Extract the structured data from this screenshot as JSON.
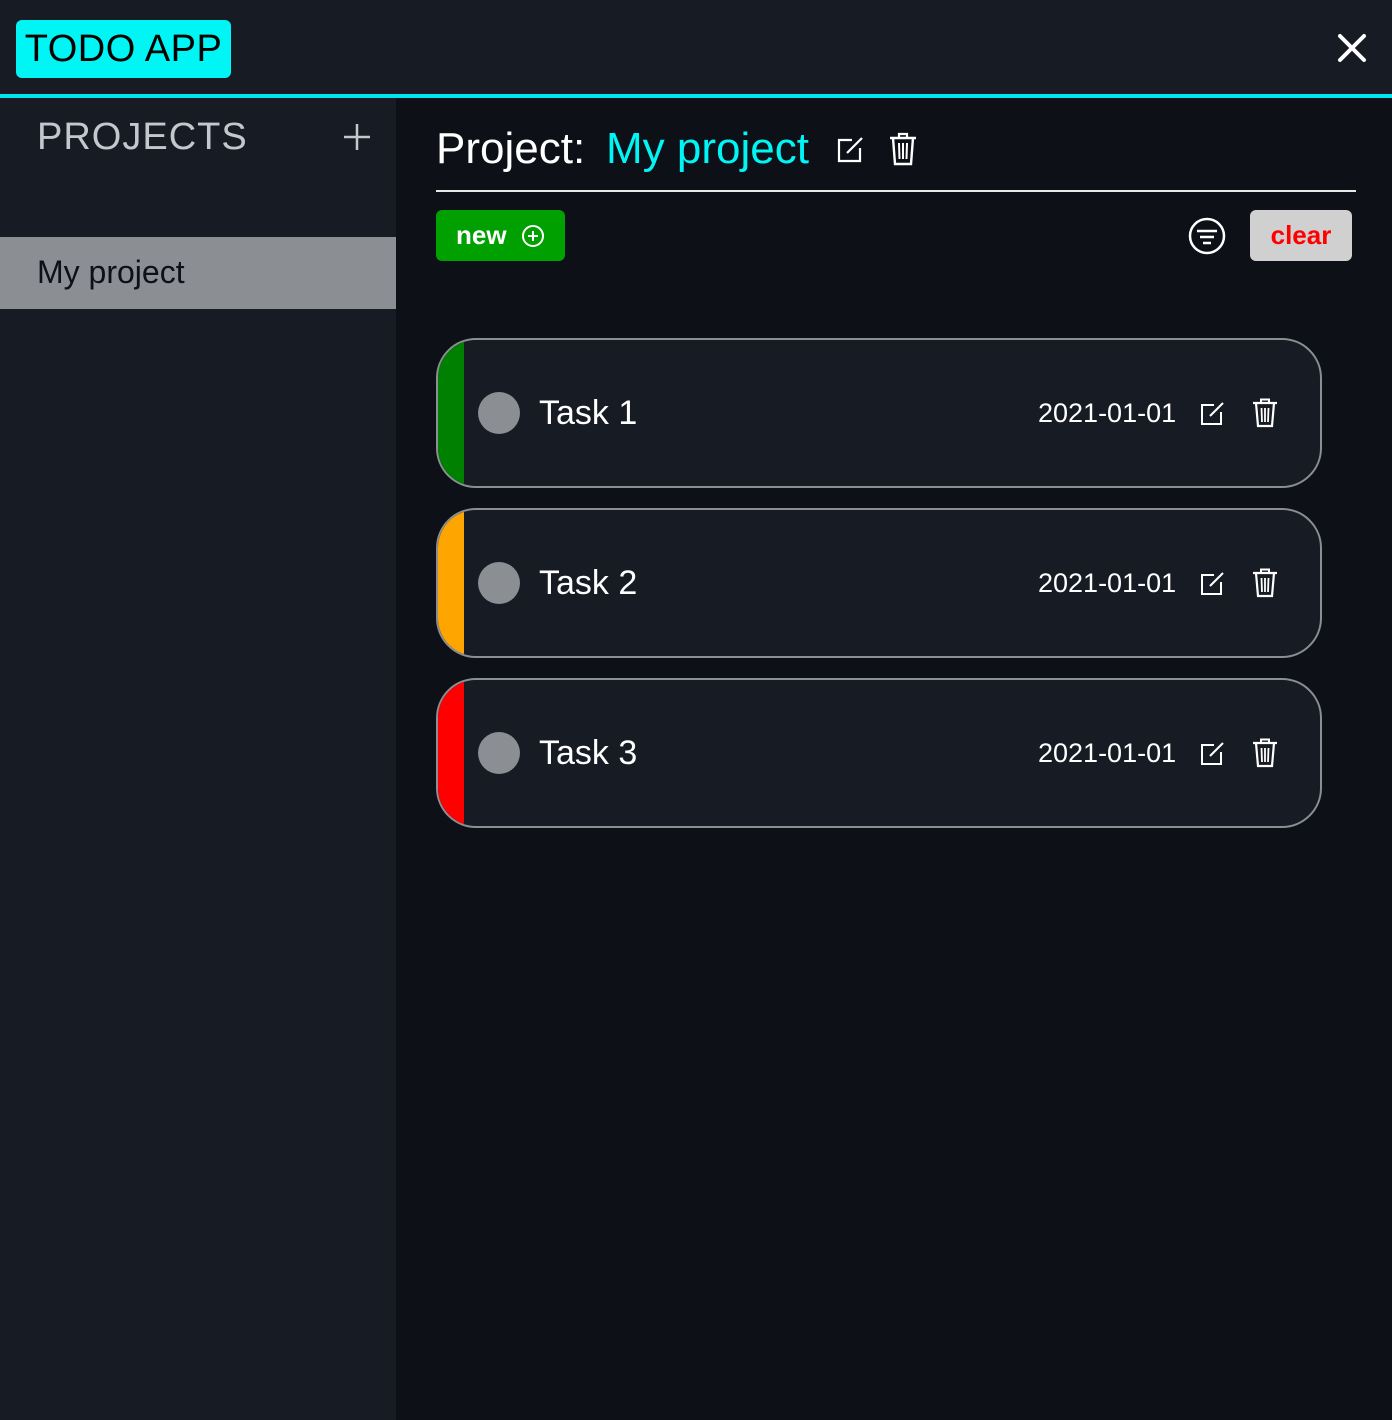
{
  "header": {
    "app_title": "TODO APP",
    "close_icon": "close-icon"
  },
  "sidebar": {
    "title": "PROJECTS",
    "add_icon": "plus-icon",
    "projects": [
      {
        "label": "My project",
        "selected": true
      }
    ]
  },
  "main": {
    "project_label": "Project:",
    "project_name": "My project",
    "new_button": "new",
    "clear_button": "clear",
    "tasks": [
      {
        "title": "Task 1",
        "date": "2021-01-01",
        "priority_color": "#008000"
      },
      {
        "title": "Task 2",
        "date": "2021-01-01",
        "priority_color": "#ffa500"
      },
      {
        "title": "Task 3",
        "date": "2021-01-01",
        "priority_color": "#ff0000"
      }
    ]
  },
  "colors": {
    "accent": "#00f5f5",
    "new_button": "#00a000",
    "clear_text": "#ff0000"
  }
}
